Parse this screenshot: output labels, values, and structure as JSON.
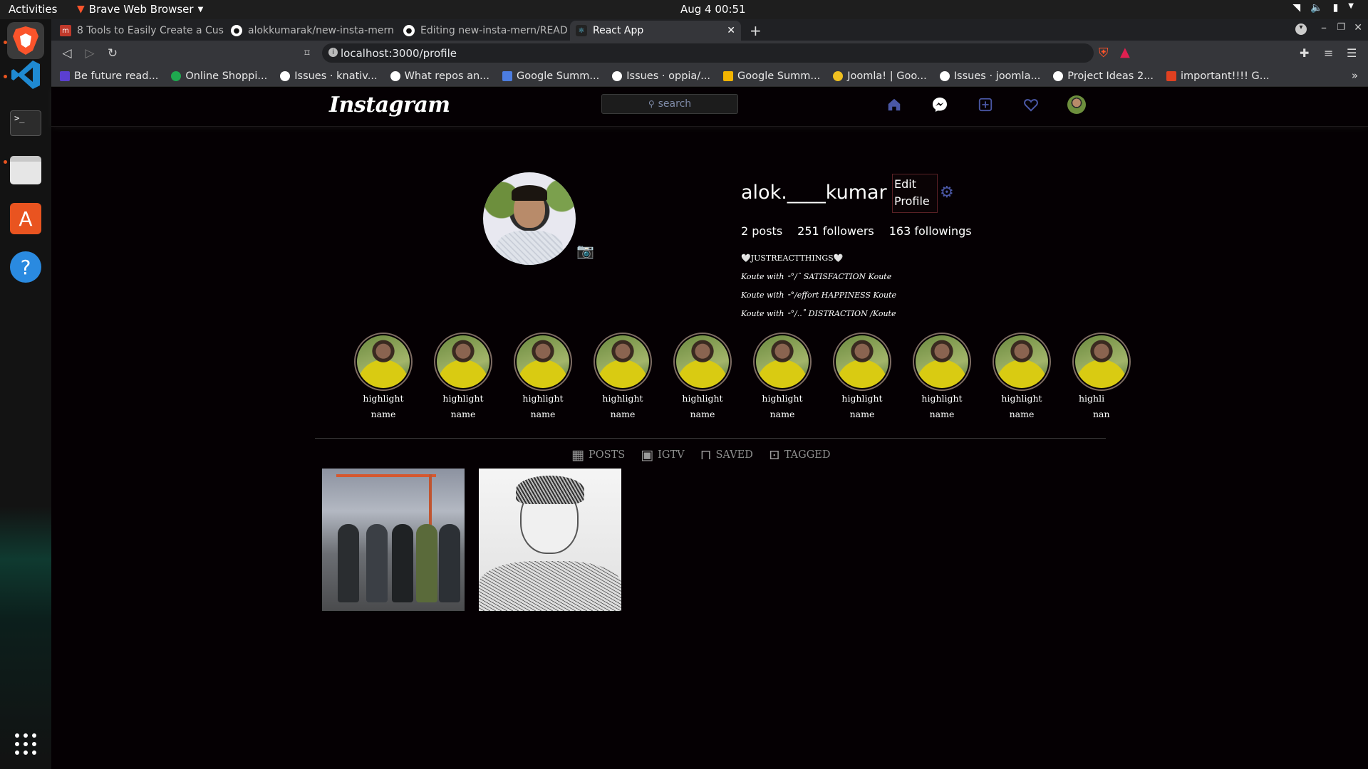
{
  "system": {
    "activities": "Activities",
    "app_name": "Brave Web Browser",
    "clock": "Aug 4  00:51"
  },
  "browser": {
    "tabs": [
      {
        "title": "8 Tools to Easily Create a Cust",
        "icon": "medium-icon"
      },
      {
        "title": "alokkumarak/new-insta-mern",
        "icon": "github-icon"
      },
      {
        "title": "Editing new-insta-mern/READ",
        "icon": "github-icon"
      },
      {
        "title": "React App",
        "icon": "react-icon"
      }
    ],
    "url": "localhost:3000/profile",
    "bookmarks": [
      {
        "label": "Be future read...",
        "color": "#5b3fd1"
      },
      {
        "label": "Online Shoppi...",
        "color": "#1fa84f"
      },
      {
        "label": "Issues · knativ...",
        "color": "#ffffff"
      },
      {
        "label": "What repos an...",
        "color": "#ffffff"
      },
      {
        "label": "Google Summ...",
        "color": "#4c7de0"
      },
      {
        "label": "Issues · oppia/...",
        "color": "#ffffff"
      },
      {
        "label": "Google Summ...",
        "color": "#f2b400"
      },
      {
        "label": "Joomla! | Goo...",
        "color": "#f0c020"
      },
      {
        "label": "Issues · joomla...",
        "color": "#ffffff"
      },
      {
        "label": "Project Ideas 2...",
        "color": "#ffffff"
      },
      {
        "label": "important!!!! G...",
        "color": "#e04020"
      }
    ]
  },
  "instagram": {
    "logo": "Instagram",
    "search_placeholder": "search",
    "profile": {
      "username": "alok.____kumar",
      "edit_line1": "Edit",
      "edit_line2": "Profile",
      "posts": "2 posts",
      "followers": "251 followers",
      "followings": "163 followings",
      "bio": [
        "🤍JUSTREACTTHINGS🤍",
        "Koute with ⁃°/ˆ SATISFACTION Koute",
        "Koute with ⁃°/effort HAPPINESS Koute",
        "Koute with ⁃°/..˚ DISTRACTION /Koute"
      ]
    },
    "highlights": [
      {
        "line1": "highlight",
        "line2": "name"
      },
      {
        "line1": "highlight",
        "line2": "name"
      },
      {
        "line1": "highlight",
        "line2": "name"
      },
      {
        "line1": "highlight",
        "line2": "name"
      },
      {
        "line1": "highlight",
        "line2": "name"
      },
      {
        "line1": "highlight",
        "line2": "name"
      },
      {
        "line1": "highlight",
        "line2": "name"
      },
      {
        "line1": "highlight",
        "line2": "name"
      },
      {
        "line1": "highlight",
        "line2": "name"
      },
      {
        "line1": "highli",
        "line2": "nan"
      }
    ],
    "profile_tabs": [
      {
        "label": "POSTS",
        "icon": "grid-icon"
      },
      {
        "label": "IGTV",
        "icon": "tv-icon"
      },
      {
        "label": "SAVED",
        "icon": "bookmark-icon"
      },
      {
        "label": "TAGGED",
        "icon": "tag-icon"
      }
    ]
  },
  "colors": {
    "background": "#050003",
    "accent_icon": "#4a57a5"
  }
}
